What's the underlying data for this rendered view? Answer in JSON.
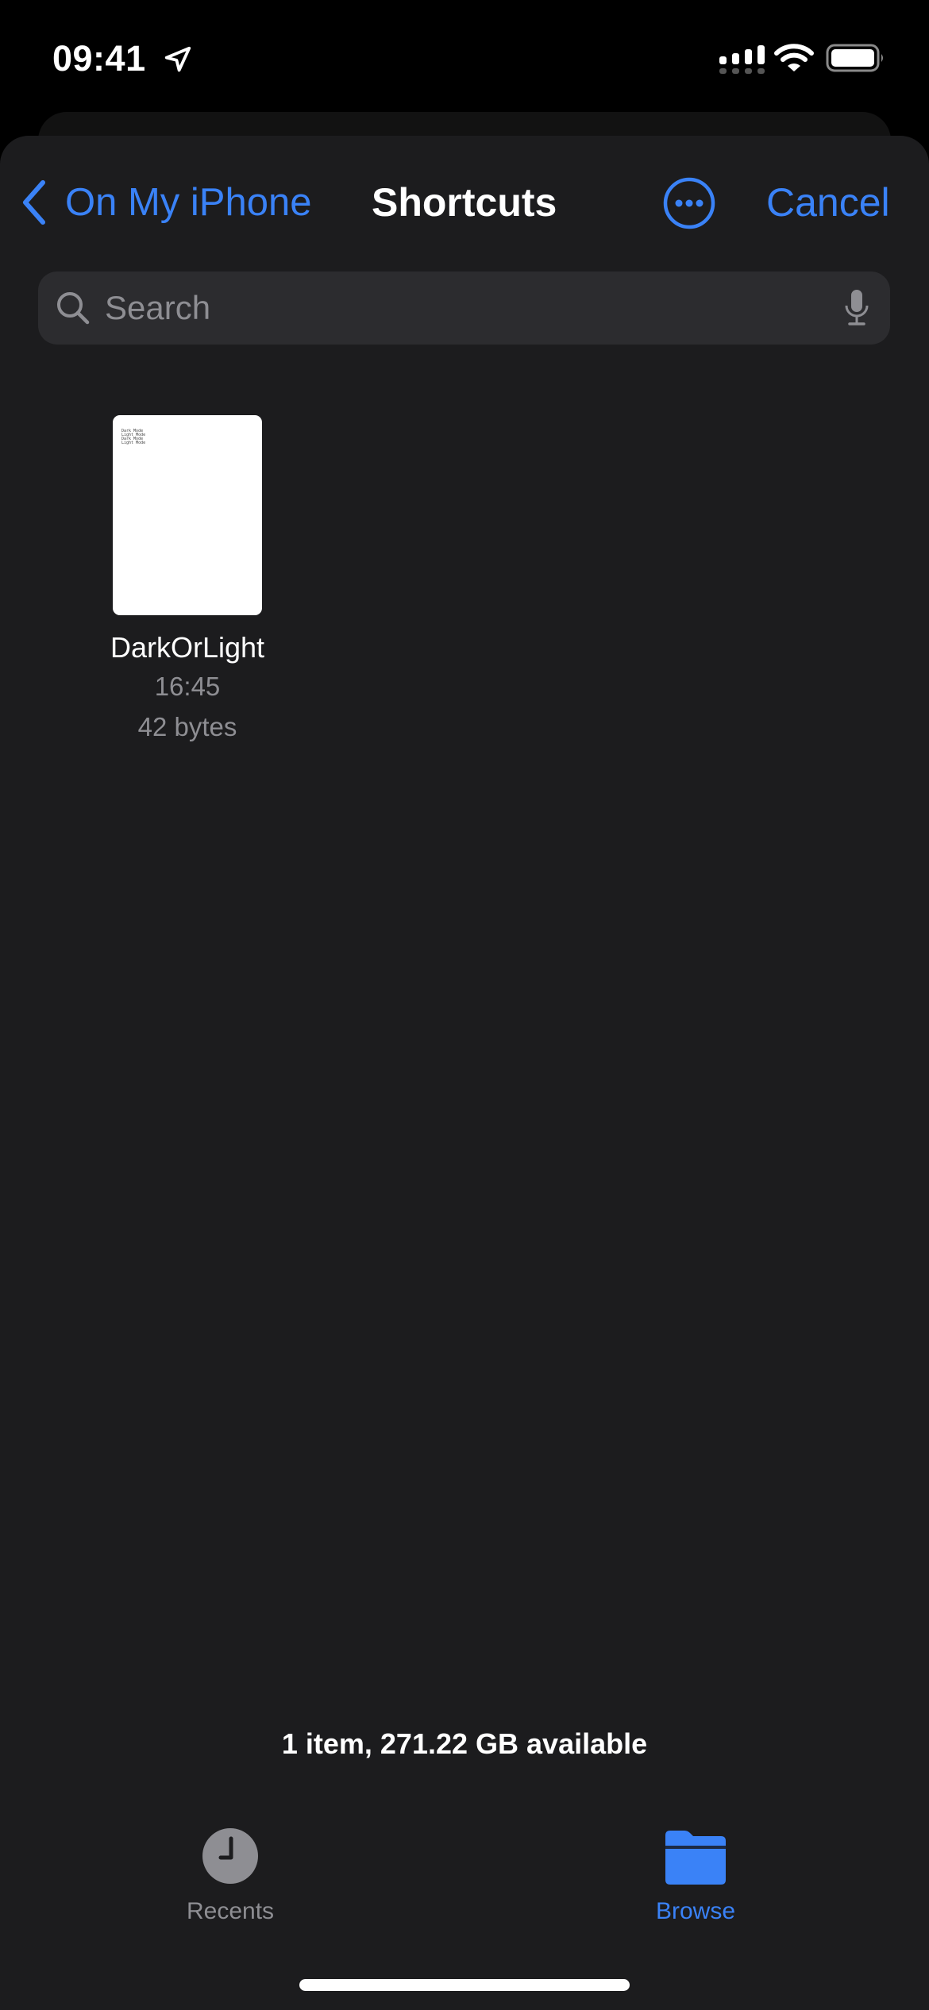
{
  "status_bar": {
    "time": "09:41",
    "icons": [
      "location-arrow-icon",
      "cellular-signal-icon",
      "wifi-icon",
      "battery-icon"
    ]
  },
  "nav": {
    "back_label": "On My iPhone",
    "title": "Shortcuts",
    "more_icon": "ellipsis-circle-icon",
    "cancel_label": "Cancel"
  },
  "search": {
    "placeholder": "Search",
    "value": ""
  },
  "files": [
    {
      "name": "DarkOrLight",
      "time": "16:45",
      "size": "42 bytes",
      "preview_lines": [
        "Dark Mode",
        "Light Mode",
        "Dark Mode",
        "Light Mode"
      ]
    }
  ],
  "footer": {
    "item_count": "1 item, 271.22 GB available"
  },
  "tabs": [
    {
      "label": "Recents",
      "icon": "clock-icon",
      "selected": false
    },
    {
      "label": "Browse",
      "icon": "folder-icon",
      "selected": true
    }
  ],
  "colors": {
    "accent": "#3a82f7",
    "sheet_background": "#1c1c1e",
    "search_background": "#2c2c2f",
    "secondary_text": "#8e8e93"
  }
}
